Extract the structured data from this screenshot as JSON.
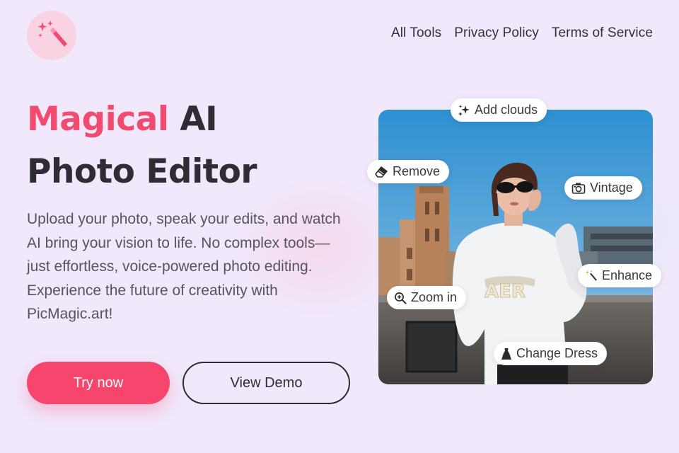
{
  "nav": {
    "items": [
      "All Tools",
      "Privacy Policy",
      "Terms of Service"
    ]
  },
  "hero": {
    "title_accent": "Magical",
    "title_rest": "AI",
    "title_line2": "Photo Editor",
    "description": "Upload your photo, speak your edits, and watch AI bring your vision to life. No complex tools—just effortless, voice-powered photo editing. Experience the future of creativity with PicMagic.art!",
    "primary_button": "Try now",
    "secondary_button": "View Demo"
  },
  "chips": {
    "add_clouds": "Add clouds",
    "remove": "Remove",
    "vintage": "Vintage",
    "enhance": "Enhance",
    "zoom_in": "Zoom in",
    "change_dress": "Change Dress"
  },
  "colors": {
    "background": "#f1e8fb",
    "accent": "#f14c70",
    "primary_button": "#f6466d",
    "logo_circle": "#f9d3e1",
    "text_dark": "#2f2c34"
  },
  "icons": {
    "logo": "magic-wand-icon",
    "add_clouds": "sparkles-icon",
    "remove": "eraser-icon",
    "vintage": "camera-icon",
    "enhance": "magic-wand-icon",
    "zoom_in": "zoom-in-icon",
    "change_dress": "dress-icon"
  }
}
